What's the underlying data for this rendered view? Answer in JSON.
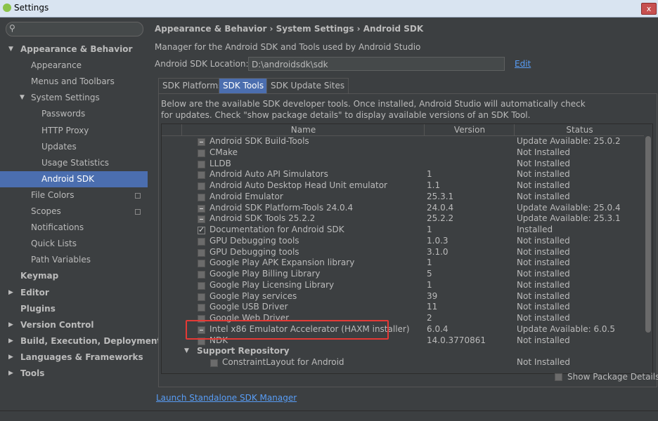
{
  "window": {
    "title": "Settings",
    "close_glyph": "x"
  },
  "sidebar": {
    "search_placeholder": "",
    "items": [
      {
        "label": "Appearance & Behavior",
        "level": 0,
        "bold": true,
        "arrow": "▼"
      },
      {
        "label": "Appearance",
        "level": 1
      },
      {
        "label": "Menus and Toolbars",
        "level": 1
      },
      {
        "label": "System Settings",
        "level": 1,
        "arrow": "▼"
      },
      {
        "label": "Passwords",
        "level": 2
      },
      {
        "label": "HTTP Proxy",
        "level": 2
      },
      {
        "label": "Updates",
        "level": 2
      },
      {
        "label": "Usage Statistics",
        "level": 2
      },
      {
        "label": "Android SDK",
        "level": 2,
        "selected": true
      },
      {
        "label": "File Colors",
        "level": 1,
        "copy": true
      },
      {
        "label": "Scopes",
        "level": 1,
        "copy": true
      },
      {
        "label": "Notifications",
        "level": 1
      },
      {
        "label": "Quick Lists",
        "level": 1
      },
      {
        "label": "Path Variables",
        "level": 1
      },
      {
        "label": "Keymap",
        "level": 0,
        "bold": true
      },
      {
        "label": "Editor",
        "level": 0,
        "bold": true,
        "arrow": "▶"
      },
      {
        "label": "Plugins",
        "level": 0,
        "bold": true
      },
      {
        "label": "Version Control",
        "level": 0,
        "bold": true,
        "arrow": "▶"
      },
      {
        "label": "Build, Execution, Deployment",
        "level": 0,
        "bold": true,
        "arrow": "▶"
      },
      {
        "label": "Languages & Frameworks",
        "level": 0,
        "bold": true,
        "arrow": "▶"
      },
      {
        "label": "Tools",
        "level": 0,
        "bold": true,
        "arrow": "▶"
      }
    ]
  },
  "main": {
    "breadcrumb": "Appearance & Behavior › System Settings › Android SDK",
    "description": "Manager for the Android SDK and Tools used by Android Studio",
    "location_label": "Android SDK Location:",
    "location_value": "D:\\androidsdk\\sdk",
    "edit_label": "Edit",
    "tabs": [
      "SDK Platforms",
      "SDK Tools",
      "SDK Update Sites"
    ],
    "active_tab": "SDK Tools",
    "intro_line1": "Below are the available SDK developer tools. Once installed, Android Studio will automatically check",
    "intro_line2": "for updates. Check \"show package details\" to display available versions of an SDK Tool.",
    "columns": {
      "name": "Name",
      "version": "Version",
      "status": "Status"
    },
    "rows": [
      {
        "name": "Android SDK Build-Tools",
        "version": "",
        "status": "Update Available: 25.0.2",
        "check": "partial"
      },
      {
        "name": "CMake",
        "version": "",
        "status": "Not Installed",
        "check": "none"
      },
      {
        "name": "LLDB",
        "version": "",
        "status": "Not Installed",
        "check": "none"
      },
      {
        "name": "Android Auto API Simulators",
        "version": "1",
        "status": "Not installed",
        "check": "none"
      },
      {
        "name": "Android Auto Desktop Head Unit emulator",
        "version": "1.1",
        "status": "Not installed",
        "check": "none"
      },
      {
        "name": "Android Emulator",
        "version": "25.3.1",
        "status": "Not installed",
        "check": "none"
      },
      {
        "name": "Android SDK Platform-Tools 24.0.4",
        "version": "24.0.4",
        "status": "Update Available: 25.0.4",
        "check": "partial"
      },
      {
        "name": "Android SDK Tools 25.2.2",
        "version": "25.2.2",
        "status": "Update Available: 25.3.1",
        "check": "partial"
      },
      {
        "name": "Documentation for Android SDK",
        "version": "1",
        "status": "Installed",
        "check": "checked"
      },
      {
        "name": "GPU Debugging tools",
        "version": "1.0.3",
        "status": "Not installed",
        "check": "none"
      },
      {
        "name": "GPU Debugging tools",
        "version": "3.1.0",
        "status": "Not installed",
        "check": "none"
      },
      {
        "name": "Google Play APK Expansion library",
        "version": "1",
        "status": "Not installed",
        "check": "none"
      },
      {
        "name": "Google Play Billing Library",
        "version": "5",
        "status": "Not installed",
        "check": "none"
      },
      {
        "name": "Google Play Licensing Library",
        "version": "1",
        "status": "Not installed",
        "check": "none"
      },
      {
        "name": "Google Play services",
        "version": "39",
        "status": "Not installed",
        "check": "none"
      },
      {
        "name": "Google USB Driver",
        "version": "11",
        "status": "Not installed",
        "check": "none"
      },
      {
        "name": "Google Web Driver",
        "version": "2",
        "status": "Not installed",
        "check": "none"
      },
      {
        "name": "Intel x86 Emulator Accelerator (HAXM installer)",
        "version": "6.0.4",
        "status": "Update Available: 6.0.5",
        "check": "partial"
      },
      {
        "name": "NDK",
        "version": "14.0.3770861",
        "status": "Not installed",
        "check": "none"
      },
      {
        "name": "Support Repository",
        "version": "",
        "status": "",
        "check": "group"
      },
      {
        "name": "ConstraintLayout for Android",
        "version": "",
        "status": "Not Installed",
        "check": "none",
        "indent": true
      }
    ],
    "show_details_label": "Show Package Details",
    "launch_label": "Launch Standalone SDK Manager"
  },
  "colors": {
    "selection": "#4b6eaf",
    "link": "#589df6",
    "highlight": "#e53935"
  }
}
